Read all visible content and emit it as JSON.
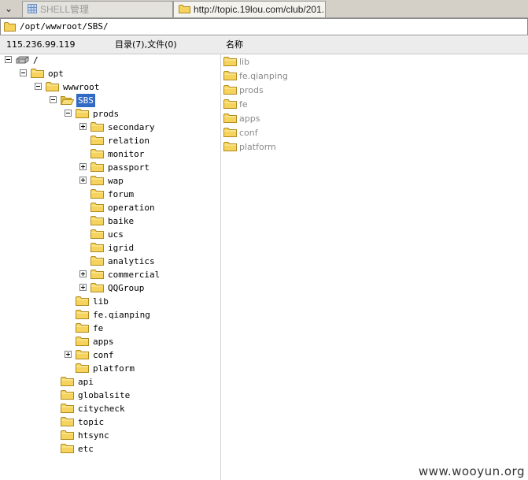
{
  "tabs": {
    "arrow": "⌄",
    "inactive_label": "SHELL管理",
    "active_label": "http://topic.19lou.com/club/201..."
  },
  "path": "/opt/wwwroot/SBS/",
  "header": {
    "ip": "115.236.99.119",
    "summary": "目录(7),文件(0)",
    "name_col": "名称"
  },
  "tree": [
    {
      "label": "/",
      "depth": 0,
      "expander": "minus",
      "icon": "drive-icon"
    },
    {
      "label": "opt",
      "depth": 1,
      "expander": "minus",
      "icon": "folder-icon"
    },
    {
      "label": "wwwroot",
      "depth": 2,
      "expander": "minus",
      "icon": "folder-icon"
    },
    {
      "label": "SBS",
      "depth": 3,
      "expander": "minus",
      "icon": "open-folder-icon",
      "selected": true
    },
    {
      "label": "prods",
      "depth": 4,
      "expander": "minus",
      "icon": "folder-icon"
    },
    {
      "label": "secondary",
      "depth": 5,
      "expander": "plus",
      "icon": "folder-icon"
    },
    {
      "label": "relation",
      "depth": 5,
      "expander": "none",
      "icon": "folder-icon"
    },
    {
      "label": "monitor",
      "depth": 5,
      "expander": "none",
      "icon": "folder-icon"
    },
    {
      "label": "passport",
      "depth": 5,
      "expander": "plus",
      "icon": "folder-icon"
    },
    {
      "label": "wap",
      "depth": 5,
      "expander": "plus",
      "icon": "folder-icon"
    },
    {
      "label": "forum",
      "depth": 5,
      "expander": "none",
      "icon": "folder-icon"
    },
    {
      "label": "operation",
      "depth": 5,
      "expander": "none",
      "icon": "folder-icon"
    },
    {
      "label": "baike",
      "depth": 5,
      "expander": "none",
      "icon": "folder-icon"
    },
    {
      "label": "ucs",
      "depth": 5,
      "expander": "none",
      "icon": "folder-icon"
    },
    {
      "label": "igrid",
      "depth": 5,
      "expander": "none",
      "icon": "folder-icon"
    },
    {
      "label": "analytics",
      "depth": 5,
      "expander": "none",
      "icon": "folder-icon"
    },
    {
      "label": "commercial",
      "depth": 5,
      "expander": "plus",
      "icon": "folder-icon"
    },
    {
      "label": "QQGroup",
      "depth": 5,
      "expander": "plus",
      "icon": "folder-icon"
    },
    {
      "label": "lib",
      "depth": 4,
      "expander": "none",
      "icon": "folder-icon"
    },
    {
      "label": "fe.qianping",
      "depth": 4,
      "expander": "none",
      "icon": "folder-icon"
    },
    {
      "label": "fe",
      "depth": 4,
      "expander": "none",
      "icon": "folder-icon"
    },
    {
      "label": "apps",
      "depth": 4,
      "expander": "none",
      "icon": "folder-icon"
    },
    {
      "label": "conf",
      "depth": 4,
      "expander": "plus",
      "icon": "folder-icon"
    },
    {
      "label": "platform",
      "depth": 4,
      "expander": "none",
      "icon": "folder-icon"
    },
    {
      "label": "api",
      "depth": 3,
      "expander": "none",
      "icon": "folder-icon"
    },
    {
      "label": "globalsite",
      "depth": 3,
      "expander": "none",
      "icon": "folder-icon"
    },
    {
      "label": "citycheck",
      "depth": 3,
      "expander": "none",
      "icon": "folder-icon"
    },
    {
      "label": "topic",
      "depth": 3,
      "expander": "none",
      "icon": "folder-icon"
    },
    {
      "label": "htsync",
      "depth": 3,
      "expander": "none",
      "icon": "folder-icon"
    },
    {
      "label": "etc",
      "depth": 3,
      "expander": "none",
      "icon": "folder-icon"
    }
  ],
  "list": [
    "lib",
    "fe.qianping",
    "prods",
    "fe",
    "apps",
    "conf",
    "platform"
  ],
  "watermark": "www.wooyun.org",
  "colors": {
    "selection": "#316ac5",
    "folder": "#f5d35c",
    "folder_edge": "#b08a1e"
  }
}
